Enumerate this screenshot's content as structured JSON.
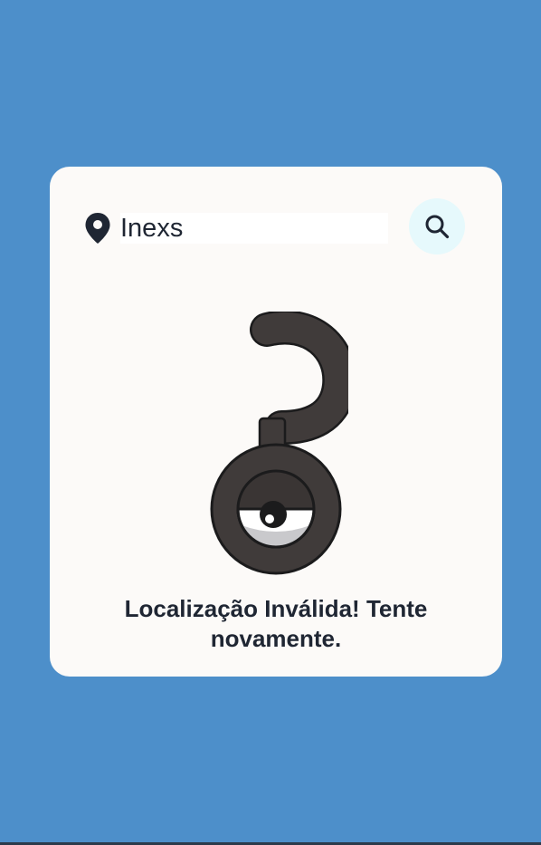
{
  "search": {
    "value": "Inexs",
    "icon": "map-pin-icon",
    "button_icon": "search-icon"
  },
  "result": {
    "illustration": "unown-pokemon-illustration",
    "message": "Localização Inválida! Tente novamente."
  },
  "colors": {
    "background": "#4d8fca",
    "card": "#fcfaf8",
    "text": "#1f2633",
    "search_button": "#e6f9fc",
    "illustration_body": "#403b3a"
  }
}
